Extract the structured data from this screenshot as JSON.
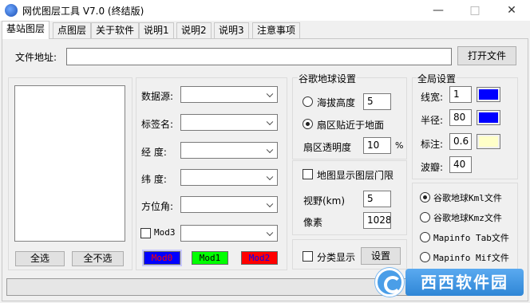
{
  "window": {
    "title": "网优图层工具 V7.0 (终结版)",
    "minimize": "—",
    "maximize": "□",
    "close": "✕"
  },
  "tabs": [
    {
      "label": "基站图层",
      "active": true
    },
    {
      "label": "点图层",
      "active": false
    },
    {
      "label": "关于软件",
      "active": false
    },
    {
      "label": "说明1",
      "active": false
    },
    {
      "label": "说明2",
      "active": false
    },
    {
      "label": "说明3",
      "active": false
    },
    {
      "label": "注意事项",
      "active": false
    }
  ],
  "file": {
    "label": "文件地址:",
    "value": "",
    "open_button": "打开文件"
  },
  "list_panel": {
    "select_all": "全选",
    "select_none": "全不选"
  },
  "fields": {
    "datasource": "数据源:",
    "tagname": "标签名:",
    "longitude": "经  度:",
    "latitude": "纬  度:",
    "azimuth": "方位角:",
    "mod3_label": "Mod3",
    "mod3_checked": false
  },
  "mod_buttons": [
    {
      "label": "Mod0",
      "color": "#0000ff"
    },
    {
      "label": "Mod1",
      "color": "#00ff00"
    },
    {
      "label": "Mod2",
      "color": "#ff0000"
    }
  ],
  "google_earth": {
    "title": "谷歌地球设置",
    "altitude_label": "海拔高度",
    "altitude_value": "5",
    "altitude_selected": false,
    "ground_label": "扇区贴近于地面",
    "ground_selected": true,
    "opacity_label": "扇区透明度",
    "opacity_value": "10",
    "opacity_unit": "%"
  },
  "threshold": {
    "checkbox_label": "地图显示图层门限",
    "checked": false,
    "view_label": "视野(km)",
    "view_value": "5",
    "pixel_label": "像素",
    "pixel_value": "1028"
  },
  "classify": {
    "checkbox_label": "分类显示",
    "checked": false,
    "settings_button": "设置"
  },
  "global": {
    "title": "全局设置",
    "line_width_label": "线宽:",
    "line_width_value": "1",
    "line_color": "#0000ff",
    "radius_label": "半径:",
    "radius_value": "80",
    "radius_color": "#0000ff",
    "label_label": "标注:",
    "label_value": "0.6",
    "label_color": "#ffffc8",
    "ripple_label": "波瓣:",
    "ripple_value": "40"
  },
  "output_formats": [
    {
      "label": "谷歌地球Kml文件",
      "selected": true
    },
    {
      "label": "谷歌地球Kmz文件",
      "selected": false
    },
    {
      "label": "Mapinfo Tab文件",
      "selected": false
    },
    {
      "label": "Mapinfo Mif文件",
      "selected": false
    }
  ],
  "watermark": {
    "text": "西西软件园"
  }
}
